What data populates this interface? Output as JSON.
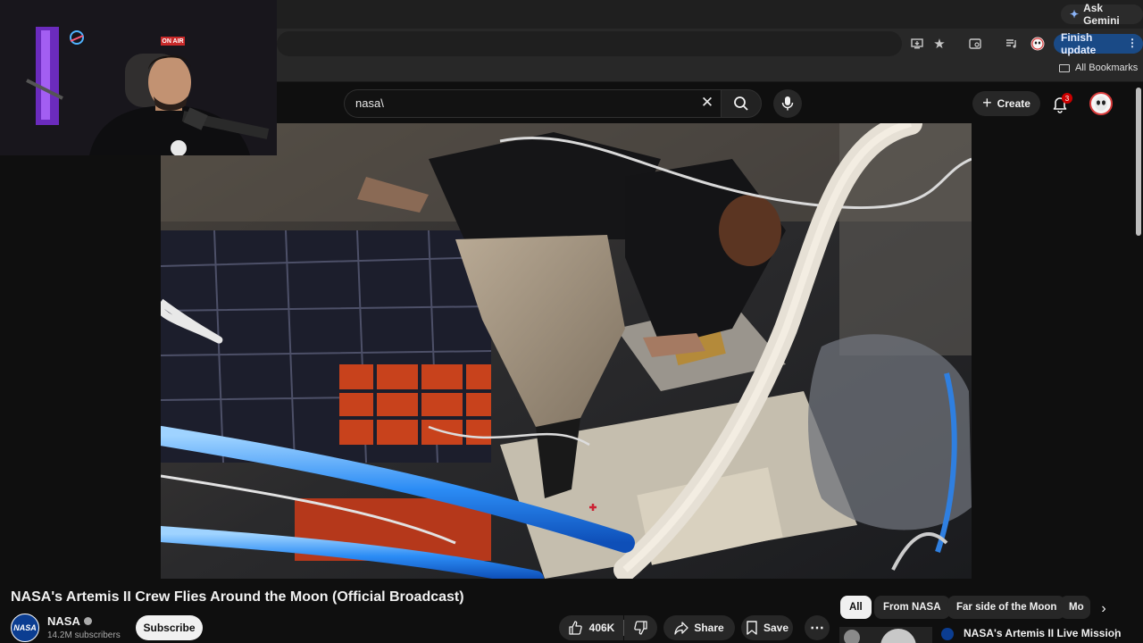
{
  "browser": {
    "ask_gemini_label": "Ask Gemini",
    "finish_update_label": "Finish update",
    "all_bookmarks_label": "All Bookmarks"
  },
  "webcam": {
    "on_air_sign": "ON AIR"
  },
  "youtube": {
    "search": {
      "value": "nasa\\",
      "placeholder": "Search"
    },
    "create_label": "Create",
    "notification_count": "3"
  },
  "video": {
    "title": "NASA's Artemis II Crew Flies Around the Moon (Official Broadcast)",
    "channel": {
      "avatar_text": "NASA",
      "name": "NASA",
      "subscribers": "14.2M subscribers"
    },
    "subscribe_label": "Subscribe",
    "likes": "406K",
    "share_label": "Share",
    "save_label": "Save"
  },
  "chips": [
    "All",
    "From NASA",
    "Far side of the Moon",
    "Mo"
  ],
  "recommendation": {
    "title": "NASA's Artemis II Live Mission"
  },
  "colors": {
    "background": "#0f0f0f",
    "accent_red": "#cc0000",
    "update_button": "#1a4a86"
  }
}
